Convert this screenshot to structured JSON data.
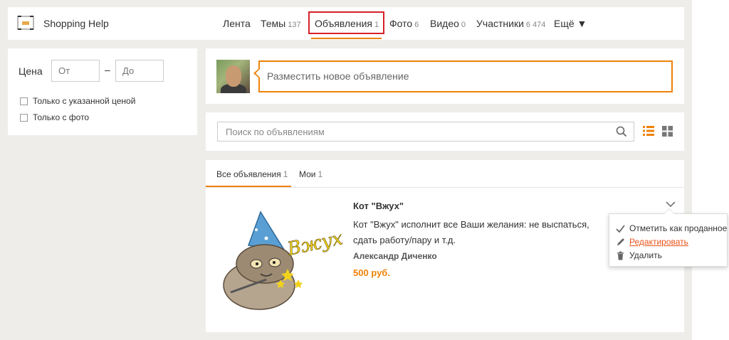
{
  "header": {
    "group_name": "Shopping Help",
    "nav": [
      {
        "label": "Лента",
        "count": ""
      },
      {
        "label": "Темы",
        "count": "137"
      },
      {
        "label": "Объявления",
        "count": "1"
      },
      {
        "label": "Фото",
        "count": "6"
      },
      {
        "label": "Видео",
        "count": "0"
      },
      {
        "label": "Участники",
        "count": "6 474"
      },
      {
        "label": "Ещё ▼",
        "count": ""
      }
    ],
    "active_nav": "Объявления"
  },
  "filter": {
    "price_label": "Цена",
    "from_placeholder": "От",
    "dash": "–",
    "to_placeholder": "До",
    "only_with_price": "Только с указанной ценой",
    "only_with_photo": "Только с фото"
  },
  "post": {
    "placeholder": "Разместить новое объявление"
  },
  "search": {
    "placeholder": "Поиск по объявлениям"
  },
  "tabs": [
    {
      "label": "Все объявления",
      "count": "1"
    },
    {
      "label": "Мои",
      "count": "1"
    }
  ],
  "listing": {
    "title": "Кот \"Вжух\"",
    "description": "Кот \"Вжух\" исполнит все Ваши желания: не выспаться, сдать работу/пару и т.д.",
    "author": "Александр Диченко",
    "price": "500 руб.",
    "image_caption": "Вжух"
  },
  "menu": {
    "mark_sold": "Отметить как проданное",
    "edit": "Редактировать",
    "delete": "Удалить"
  },
  "colors": {
    "accent": "#ee8208",
    "highlight": "#d6202a",
    "link": "#e8541a"
  }
}
